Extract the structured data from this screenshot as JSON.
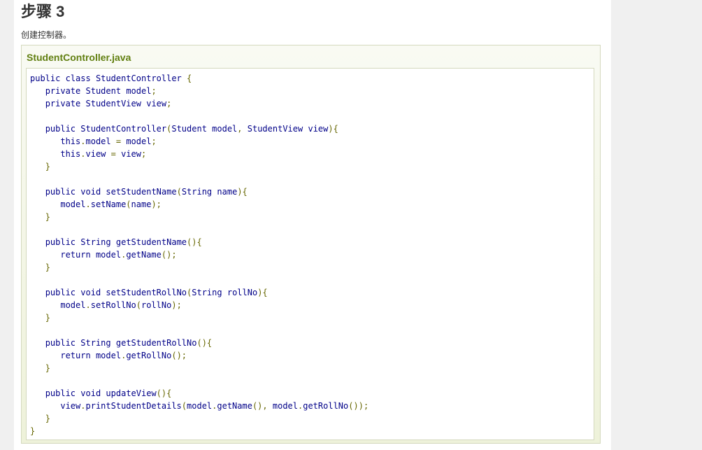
{
  "page": {
    "step_title": "步骤 3",
    "step_description": "创建控制器。"
  },
  "example": {
    "file_name": "StudentController.java",
    "code_lines": [
      "public class StudentController {",
      "   private Student model;",
      "   private StudentView view;",
      "",
      "   public StudentController(Student model, StudentView view){",
      "      this.model = model;",
      "      this.view = view;",
      "   }",
      "",
      "   public void setStudentName(String name){",
      "      model.setName(name);",
      "   }",
      "",
      "   public String getStudentName(){",
      "      return model.getName();",
      "   }",
      "",
      "   public void setStudentRollNo(String rollNo){",
      "      model.setRollNo(rollNo);",
      "   }",
      "",
      "   public String getStudentRollNo(){",
      "      return model.getRollNo();",
      "   }",
      "",
      "   public void updateView(){",
      "      view.printStudentDetails(model.getName(), model.getRollNo());",
      "   }",
      "}"
    ]
  },
  "colors": {
    "keyword": "#000088",
    "type": "#660066",
    "identifier": "#000000",
    "punctuation": "#666600",
    "file_name": "#617f10"
  }
}
